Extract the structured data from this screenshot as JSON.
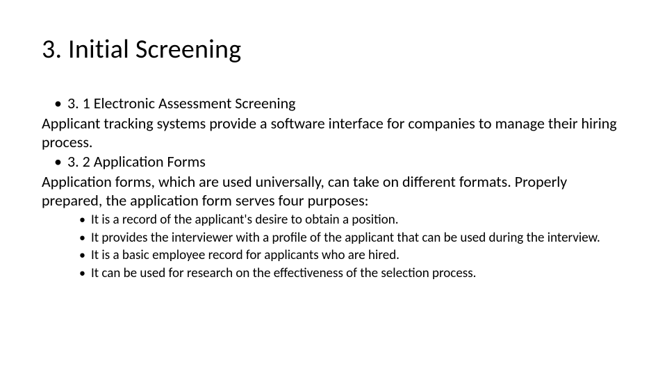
{
  "title": "3. Initial Screening",
  "items": [
    {
      "type": "bullet",
      "text": "3. 1 Electronic Assessment Screening"
    },
    {
      "type": "para",
      "text": "Applicant tracking systems provide a software interface for companies to manage their hiring process."
    },
    {
      "type": "bullet",
      "text": "3. 2 Application Forms"
    },
    {
      "type": "para",
      "text": "Application forms, which are used universally, can take on different formats. Properly prepared, the application form serves four purposes:"
    }
  ],
  "subitems": [
    "It is a record of the applicant's desire to obtain a position.",
    "It provides the interviewer with a profile of the applicant that can be used during the interview.",
    "It is a basic employee record for applicants who are hired.",
    "It can be used for research on the effectiveness of the selection process."
  ]
}
